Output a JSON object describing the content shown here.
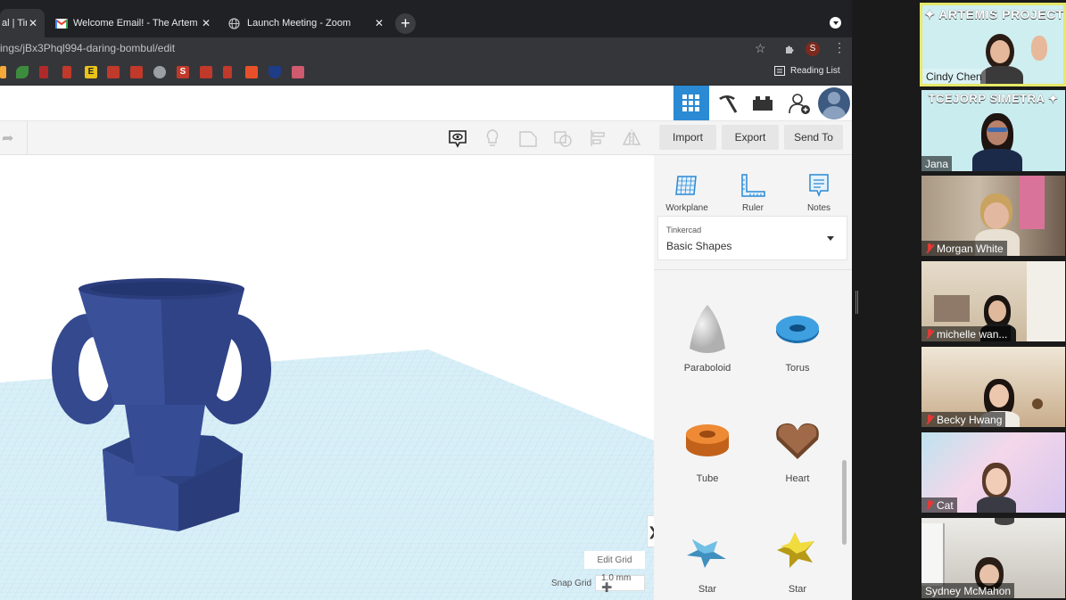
{
  "browser": {
    "tabs": [
      {
        "label": "al | Tin",
        "active": true
      },
      {
        "label": "Welcome Email! - The Artemis",
        "icon": "gmail-icon"
      },
      {
        "label": "Launch Meeting - Zoom",
        "icon": "globe-icon"
      }
    ],
    "new_tab": "+",
    "url": "ings/jBx3Phql994-daring-bombul/edit",
    "profile_initial": "S",
    "reading_list": "Reading List",
    "bookmark_letters": [
      "E",
      "S"
    ]
  },
  "tinkercad": {
    "actions": {
      "import": "Import",
      "export": "Export",
      "send_to": "Send To"
    },
    "panel_tools": [
      {
        "label": "Workplane",
        "icon": "workplane-icon"
      },
      {
        "label": "Ruler",
        "icon": "ruler-icon"
      },
      {
        "label": "Notes",
        "icon": "notes-icon"
      }
    ],
    "library": {
      "source": "Tinkercad",
      "selected": "Basic Shapes"
    },
    "shapes": [
      {
        "label": "Paraboloid",
        "color": "#d8d8d8"
      },
      {
        "label": "Torus",
        "color": "#2f8fd0"
      },
      {
        "label": "Tube",
        "color": "#e07b22"
      },
      {
        "label": "Heart",
        "color": "#8a5a3c"
      },
      {
        "label": "Star",
        "color": "#5aaed8"
      },
      {
        "label": "Star",
        "color": "#e9d23a"
      }
    ],
    "viewport": {
      "edit_grid": "Edit Grid",
      "snap_grid_label": "Snap Grid",
      "snap_grid_value": "1.0 mm ➕",
      "collapse": "❯"
    },
    "model_color": "#34498e",
    "accent": "#2a8ad4"
  },
  "zoom": {
    "participants": [
      {
        "name": "Cindy Chen",
        "muted": false,
        "active_speaker": true,
        "banner": "✦ ARTEMIS PROJECT"
      },
      {
        "name": "Jana",
        "muted": false,
        "banner": "TCEJORP SIMETRA ✦"
      },
      {
        "name": "Morgan White",
        "muted": true
      },
      {
        "name": "michelle wan...",
        "muted": true
      },
      {
        "name": "Becky Hwang",
        "muted": true
      },
      {
        "name": "Cat",
        "muted": true
      },
      {
        "name": "Sydney McMahon",
        "muted": false
      }
    ]
  }
}
